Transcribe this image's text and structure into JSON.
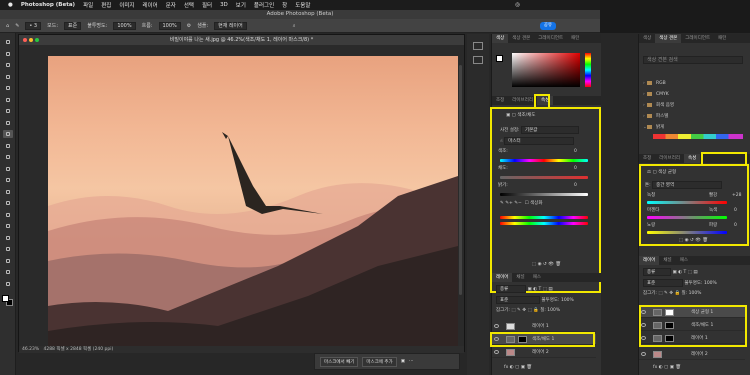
{
  "menubar": {
    "app": "Photoshop (Beta)",
    "items": [
      "파일",
      "편집",
      "이미지",
      "레이어",
      "문자",
      "선택",
      "필터",
      "3D",
      "보기",
      "플러그인",
      "창",
      "도움말"
    ]
  },
  "window_title": "Adobe Photoshop (Beta)",
  "options": {
    "mode_label": "모드:",
    "mode_value": "표준",
    "opacity_label": "불투명도:",
    "opacity_value": "100%",
    "flow_label": "흐름:",
    "flow_value": "100%",
    "sample_label": "샘플:",
    "sample_value": "현재 레이어",
    "share": "공유"
  },
  "document": {
    "title": "비밀이야를 나는 새.jpg @ 46.2%(색조/채도 1, 레이어 마스크/8) *",
    "zoom": "46.23%",
    "info": "4288 픽셀 x 2848 픽셀 (240 ppi)"
  },
  "mask_bar": {
    "remove": "마스크에서 빼기",
    "add": "마스크에 추가"
  },
  "mid_panel": {
    "color_tabs": [
      "색상",
      "색상 견본",
      "그레이디언트",
      "패턴"
    ],
    "prop_tabs": [
      "조정",
      "라이브러리",
      "속성"
    ],
    "props_title": "색조/채도",
    "preset_label": "사전 설정:",
    "preset_value": "기본값",
    "channel_value": "마스터",
    "hue_label": "색조:",
    "hue_value": "0",
    "sat_label": "채도:",
    "sat_value": "0",
    "light_label": "밝기:",
    "light_value": "0",
    "colorize_label": "색상화",
    "layer_tabs": [
      "레이어",
      "채널",
      "패스"
    ],
    "kind_label": "종류",
    "blend_value": "표준",
    "opacity_label": "불투명도:",
    "opacity_value": "100%",
    "lock_label": "잠그기:",
    "fill_label": "칠:",
    "fill_value": "100%",
    "layers": [
      "레이어 1",
      "색조/채도 1",
      "레이어 2"
    ]
  },
  "right_panel": {
    "swatch_tabs": [
      "색상",
      "색상 견본",
      "그레이디언트",
      "패턴"
    ],
    "search_placeholder": "색상 견본 검색",
    "folders": [
      "RGB",
      "CMYK",
      "회색 음영",
      "파스텔",
      "밝게"
    ],
    "prop_tabs": [
      "조정",
      "라이브러리",
      "속성"
    ],
    "props_title": "색상 균형",
    "tone_label": "톤:",
    "tone_value": "중간 영역",
    "cyan_label": "녹청",
    "red_label": "빨강",
    "red_value": "+28",
    "magenta_label": "마젠타",
    "green_label": "녹색",
    "green_value": "0",
    "yellow_label": "노랑",
    "blue_label": "파랑",
    "blue_value": "0",
    "layer_tabs": [
      "레이어",
      "채널",
      "패스"
    ],
    "kind_label": "종류",
    "blend_value": "표준",
    "opacity_label": "불투명도:",
    "opacity_value": "100%",
    "lock_label": "잠그기:",
    "fill_label": "칠:",
    "fill_value": "100%",
    "layers": [
      "색상 균형 1",
      "색조/채도 1",
      "레이어 1",
      "레이어 2"
    ]
  }
}
